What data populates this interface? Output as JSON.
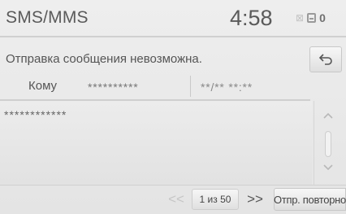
{
  "header": {
    "title": "SMS/MMS",
    "clock": "4:58",
    "battery_label": "0"
  },
  "status": {
    "error_text": "Отправка сообщения невозможна."
  },
  "recipient": {
    "label": "Кому",
    "value": "**********",
    "datetime": "**/** **:**"
  },
  "message": {
    "body": "************"
  },
  "pagination": {
    "prev": "<<",
    "page": "1 из 50",
    "next": ">>"
  },
  "actions": {
    "back_icon": "back-arrow-icon",
    "resend_label": "Отпр. повторно"
  },
  "colors": {
    "background": "#e8e8e8",
    "text": "#555555",
    "disabled": "#c6c6c6"
  }
}
